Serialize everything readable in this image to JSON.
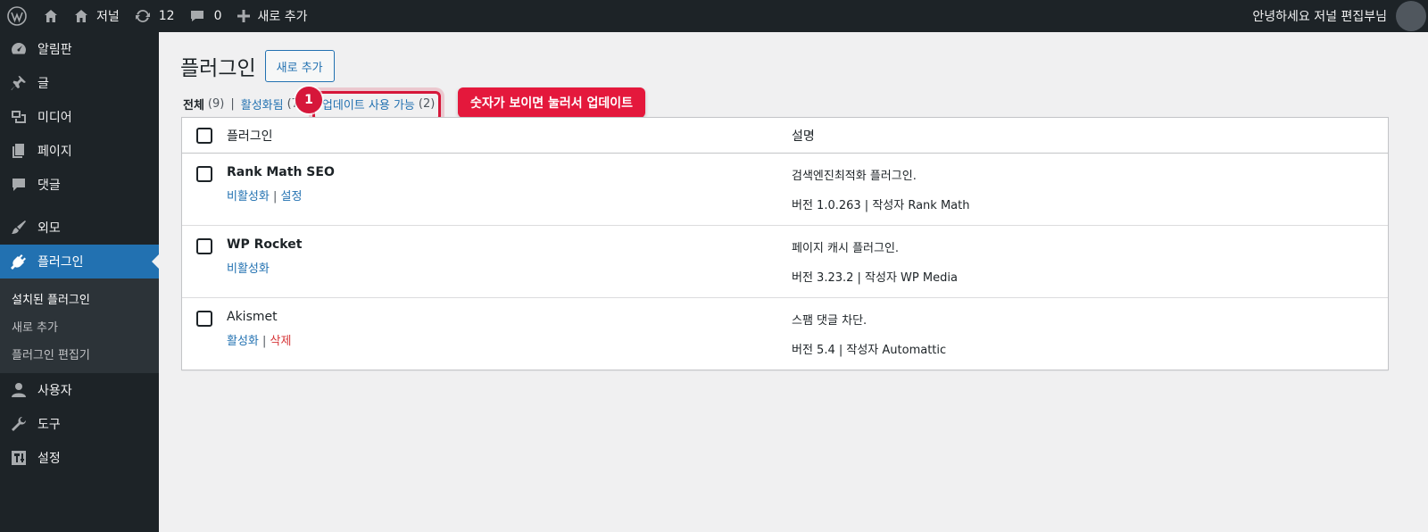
{
  "adminbar": {
    "site_name": "저널",
    "updates_count": "12",
    "comments_count": "0",
    "new_label": "새로 추가",
    "greeting": "안녕하세요 저널 편집부님"
  },
  "sidebar": {
    "items": [
      {
        "label": "알림판",
        "icon": "dashboard-icon"
      },
      {
        "label": "글",
        "icon": "pin-icon"
      },
      {
        "label": "미디어",
        "icon": "media-icon"
      },
      {
        "label": "페이지",
        "icon": "page-icon"
      },
      {
        "label": "댓글",
        "icon": "comment-icon"
      },
      {
        "label": "외모",
        "icon": "brush-icon"
      },
      {
        "label": "플러그인",
        "icon": "plugin-icon"
      },
      {
        "label": "사용자",
        "icon": "user-icon"
      },
      {
        "label": "도구",
        "icon": "wrench-icon"
      },
      {
        "label": "설정",
        "icon": "settings-icon"
      }
    ],
    "submenu": [
      "설치된 플러그인",
      "새로 추가",
      "플러그인 편집기"
    ]
  },
  "main": {
    "title": "플러그인",
    "add_new": "새로 추가",
    "filters": {
      "all_label": "전체",
      "all_count": "(9)",
      "active_label": "활성화됨",
      "active_count": "(7",
      "update_label": "업데이트 사용 가능",
      "update_count": "(2)"
    },
    "annotation": {
      "number": "1",
      "callout": "숫자가 보이면 눌러서 업데이트"
    },
    "table": {
      "col_name": "플러그인",
      "col_desc": "설명",
      "rows": [
        {
          "name": "Rank Math SEO",
          "actions": [
            "비활성화",
            "설정"
          ],
          "description": "검색엔진최적화 플러그인.",
          "meta": "버전 1.0.263 | 작성자 Rank Math"
        },
        {
          "name": "WP Rocket",
          "actions": [
            "비활성화"
          ],
          "description": "페이지 캐시 플러그인.",
          "meta": "버전 3.23.2 | 작성자 WP Media"
        },
        {
          "name": "Akismet",
          "actions": [
            "활성화",
            "삭제"
          ],
          "description": "스팸 댓글 차단.",
          "meta": "버전 5.4 | 작성자 Automattic"
        }
      ]
    }
  },
  "colors": {
    "accent": "#2271b1",
    "annotation_red": "#e4183c",
    "adminbar_bg": "#1d2327"
  }
}
